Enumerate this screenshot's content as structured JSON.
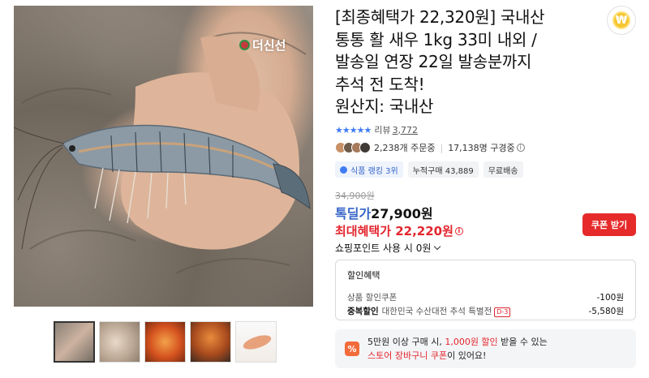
{
  "image": {
    "watermark": "더신선",
    "thumbnail_count": 5
  },
  "product": {
    "title_lines": [
      "[최종혜택가 22,320원] 국내산",
      "통통 활 새우 1kg 33미 내외 /",
      "발송일 연장 22일 발송분까지",
      "추석 전 도착!",
      "원산지: 국내산"
    ]
  },
  "rating": {
    "stars": "★★★★★",
    "stars_value": 4.5,
    "review_label": "리뷰",
    "review_count": "3,772"
  },
  "stats": {
    "orders": "2,238개 주문중",
    "watching": "17,138명 구경중"
  },
  "badges": {
    "rank": "식품 랭킹 3위",
    "cumulative": "누적구매 43,889",
    "shipping": "무료배송"
  },
  "price": {
    "original": "34,900원",
    "deal_label": "톡딜가",
    "deal_value": "27,900원",
    "max_benefit": "최대혜택가 22,220원",
    "points": "쇼핑포인트 사용 시 0원"
  },
  "coupon_button": "쿠폰 받기",
  "discount": {
    "title": "할인혜택",
    "row1_label": "상품 할인쿠폰",
    "row1_value": "-100원",
    "row2_bold": "중복할인",
    "row2_label": "대한민국 수산대전 추석 특별전",
    "row2_dday": "D-3",
    "row2_value": "-5,580원"
  },
  "promo": {
    "icon": "%",
    "line1_pre": "5만원 이상 구매 시, ",
    "line1_hl": "1,000원 할인",
    "line1_post": " 받을 수 있는",
    "line2_hl": "스토어 장바구니 쿠폰",
    "line2_post": "이 있어요!"
  },
  "colors": {
    "accent_red": "#e3262e",
    "accent_blue": "#3565c8",
    "coupon_red": "#e62a2a"
  },
  "icons": {
    "coin": "coin-icon",
    "info": "info-icon",
    "chevron": "chevron-down-icon",
    "promo": "percent-icon"
  }
}
